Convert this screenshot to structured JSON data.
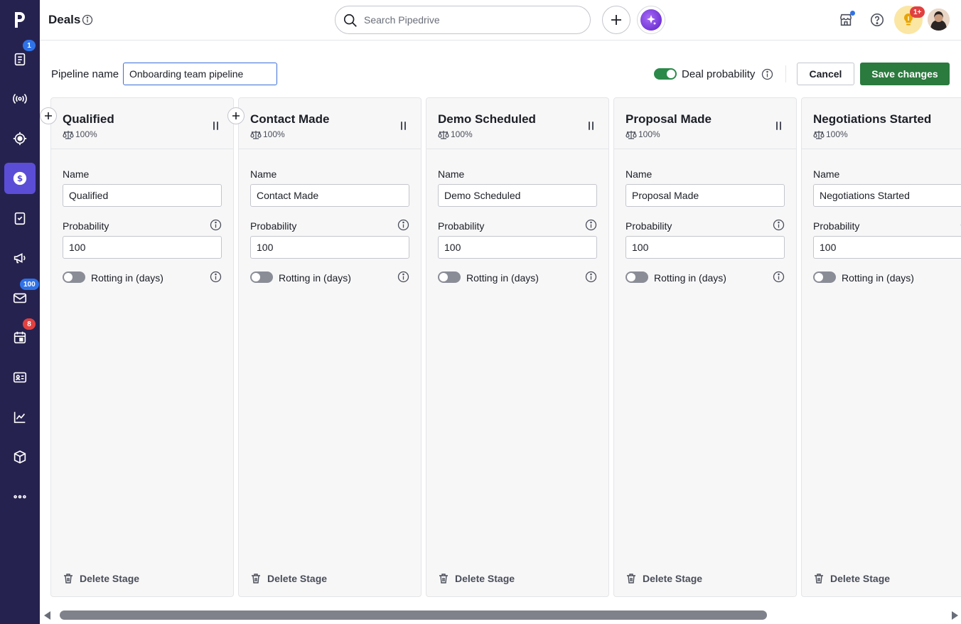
{
  "header": {
    "title": "Deals",
    "search_placeholder": "Search Pipedrive",
    "notifications_badge": "1+"
  },
  "sidebar": {
    "items": [
      {
        "name": "leads",
        "icon": "clipboard-list-icon",
        "badge": "1",
        "badge_color": "#2f72e8"
      },
      {
        "name": "campaigns",
        "icon": "broadcast-icon"
      },
      {
        "name": "projects",
        "icon": "target-icon"
      },
      {
        "name": "deals",
        "icon": "dollar-icon",
        "active": true
      },
      {
        "name": "activities",
        "icon": "checklist-icon"
      },
      {
        "name": "marketing",
        "icon": "megaphone-icon"
      },
      {
        "name": "mail",
        "icon": "mail-icon",
        "badge": "100",
        "badge_color": "#2f72e8"
      },
      {
        "name": "calendar",
        "icon": "calendar-icon",
        "badge": "8",
        "badge_color": "#e14040"
      },
      {
        "name": "contacts",
        "icon": "id-card-icon"
      },
      {
        "name": "insights",
        "icon": "chart-icon"
      },
      {
        "name": "products",
        "icon": "box-icon"
      },
      {
        "name": "more",
        "icon": "more-icon"
      }
    ]
  },
  "pipeline": {
    "name_label": "Pipeline name",
    "name_value": "Onboarding team pipeline",
    "deal_probability_label": "Deal probability",
    "deal_probability_on": true,
    "cancel_label": "Cancel",
    "save_label": "Save changes"
  },
  "stage_labels": {
    "name": "Name",
    "probability": "Probability",
    "rotting": "Rotting in (days)",
    "delete": "Delete Stage"
  },
  "stages": [
    {
      "title": "Qualified",
      "probability_badge": "100%",
      "name": "Qualified",
      "probability": "100"
    },
    {
      "title": "Contact Made",
      "probability_badge": "100%",
      "name": "Contact Made",
      "probability": "100"
    },
    {
      "title": "Demo Scheduled",
      "probability_badge": "100%",
      "name": "Demo Scheduled",
      "probability": "100"
    },
    {
      "title": "Proposal Made",
      "probability_badge": "100%",
      "name": "Proposal Made",
      "probability": "100"
    },
    {
      "title": "Negotiations Started",
      "probability_badge": "100%",
      "name": "Negotiations Started",
      "probability": "100"
    }
  ],
  "colors": {
    "sidebar_bg": "#26224f",
    "sidebar_active": "#5b4dd6",
    "primary_green": "#2b7a3e",
    "toggle_on": "#2b8a4a",
    "input_focus": "#3c6fd6"
  }
}
